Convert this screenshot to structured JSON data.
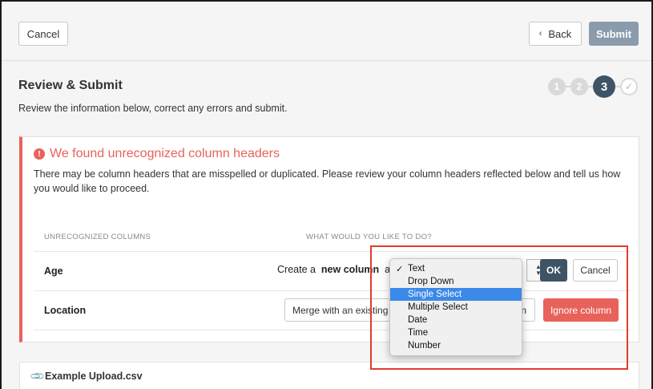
{
  "topbar": {
    "cancel_label": "Cancel",
    "back_label": "Back",
    "submit_label": "Submit"
  },
  "header": {
    "title": "Review & Submit",
    "subtitle": "Review the information below, correct any errors and submit."
  },
  "steps": {
    "items": [
      "1",
      "2",
      "3",
      "✓"
    ],
    "current": 3
  },
  "error_card": {
    "title": "We found unrecognized column headers",
    "description": "There may be column headers that are misspelled or duplicated. Please review your column headers reflected below and tell us how you would like to proceed.",
    "col_unrecognized": "UNRECOGNIZED COLUMNS",
    "col_action": "WHAT WOULD YOU LIKE TO DO?",
    "rows": [
      {
        "label": "Age",
        "create_prefix": "Create a",
        "create_bold": "new column",
        "create_suffix": "as",
        "ok_label": "OK",
        "cancel_label": "Cancel"
      },
      {
        "label": "Location",
        "merge_text": "Merge with an existing c",
        "merge_tail": "n",
        "ignore_label": "Ignore column"
      }
    ]
  },
  "dropdown": {
    "checked": "Text",
    "highlighted": "Single Select",
    "options": [
      "Text",
      "Drop Down",
      "Single Select",
      "Multiple Select",
      "Date",
      "Time",
      "Number"
    ]
  },
  "file": {
    "name": "Example Upload.csv"
  },
  "colors": {
    "accent_dark": "#3f5366",
    "error": "#e8625b",
    "highlight_select": "#3b89e8",
    "annotation_box": "#e23b2e"
  }
}
